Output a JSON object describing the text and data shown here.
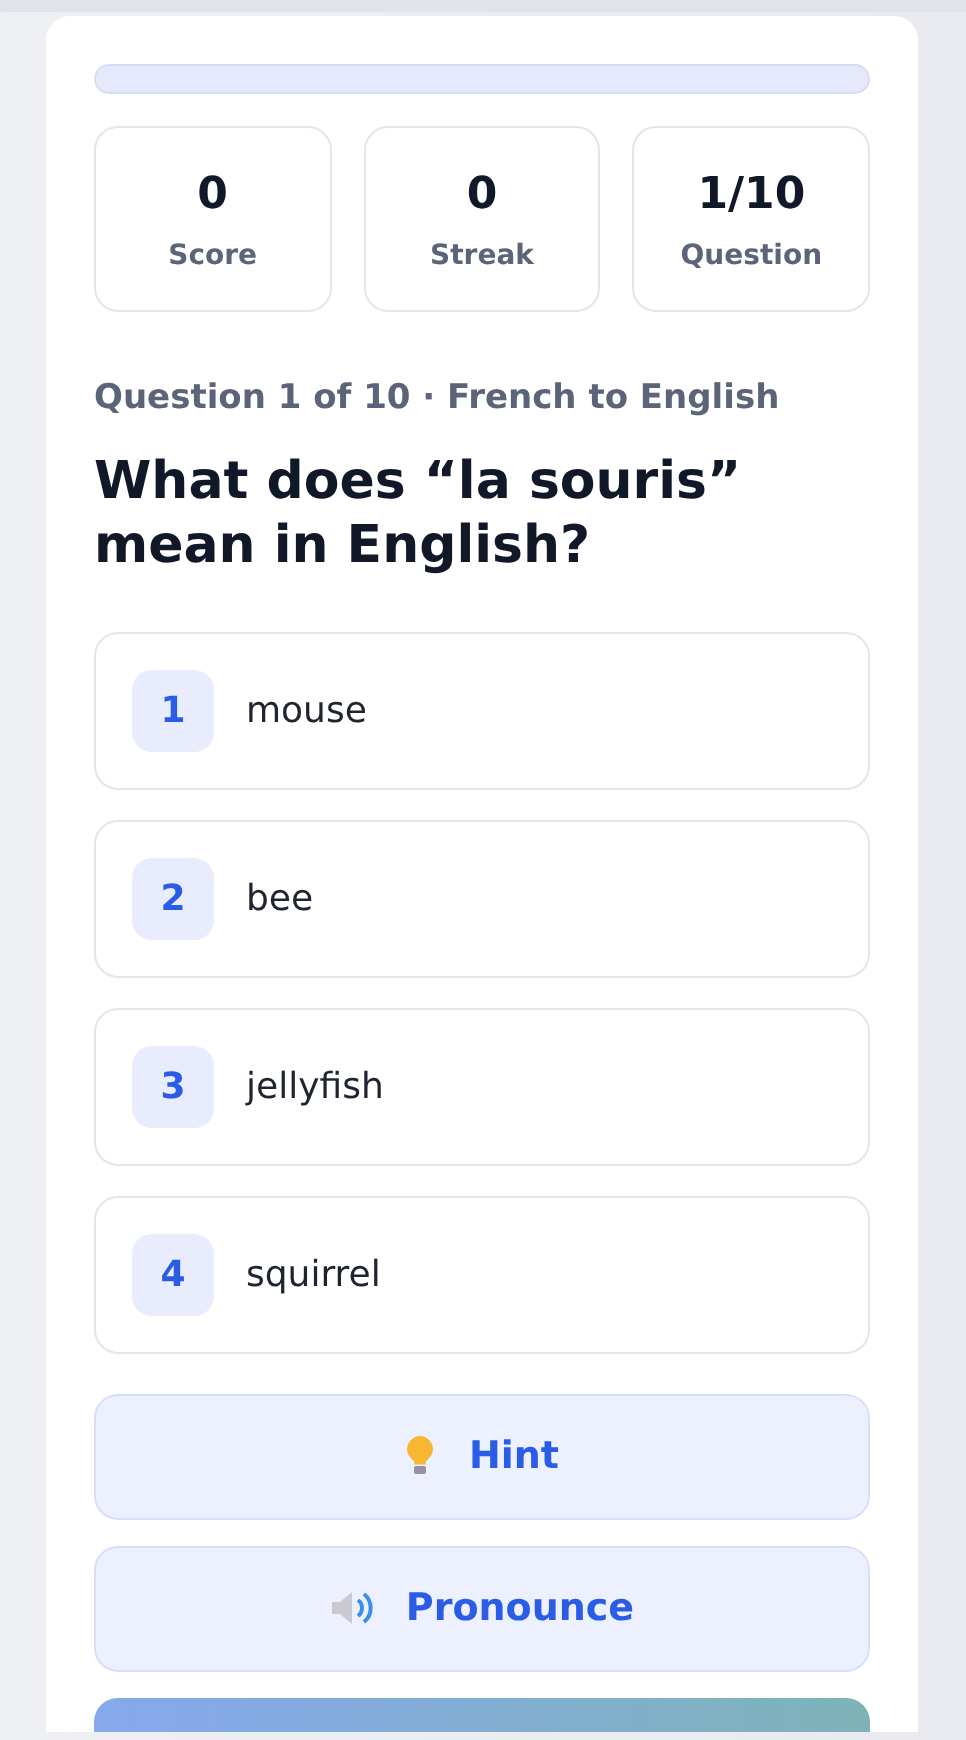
{
  "progress": {
    "level": 0
  },
  "stats": [
    {
      "value": "0",
      "label": "Score"
    },
    {
      "value": "0",
      "label": "Streak"
    },
    {
      "value": "1/10",
      "label": "Question"
    }
  ],
  "meta": "Question 1 of 10 · French to English",
  "question": "What does “la souris” mean in English?",
  "options": [
    {
      "number": "1",
      "text": "mouse"
    },
    {
      "number": "2",
      "text": "bee"
    },
    {
      "number": "3",
      "text": "jellyfish"
    },
    {
      "number": "4",
      "text": "squirrel"
    }
  ],
  "actions": [
    {
      "kind": "hint",
      "label": "Hint"
    },
    {
      "kind": "pronounce",
      "label": "Pronounce"
    }
  ]
}
